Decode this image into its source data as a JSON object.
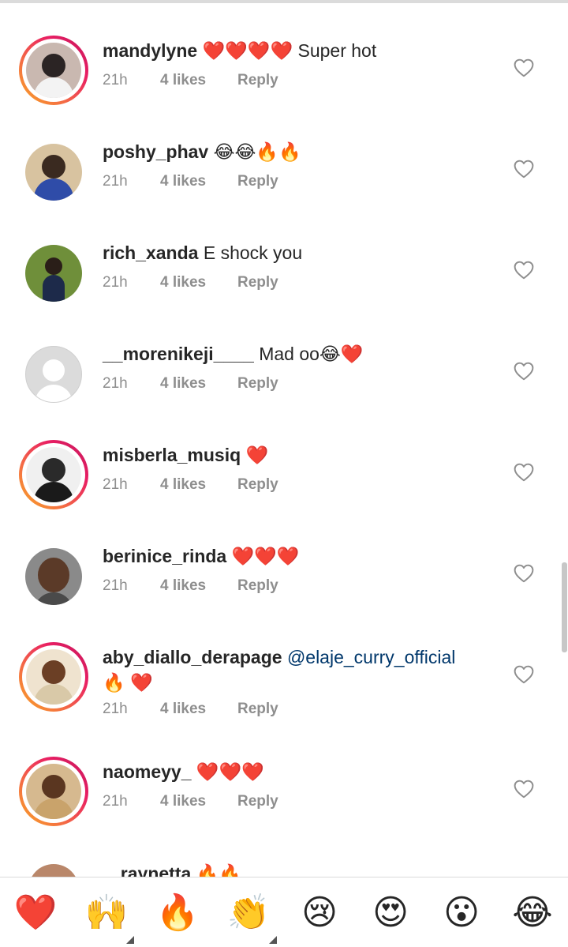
{
  "comments": [
    {
      "username": "mandylyne",
      "text": "❤️❤️❤️❤️ Super hot",
      "mention": "",
      "time": "21h",
      "likes": "4 likes",
      "reply": "Reply"
    },
    {
      "username": "poshy_phav",
      "text": "😂😂🔥🔥",
      "mention": "",
      "time": "21h",
      "likes": "4 likes",
      "reply": "Reply"
    },
    {
      "username": "rich_xanda",
      "text": "E shock you",
      "mention": "",
      "time": "21h",
      "likes": "4 likes",
      "reply": "Reply"
    },
    {
      "username": "__morenikeji____",
      "text": "Mad oo😂❤️",
      "mention": "",
      "time": "21h",
      "likes": "4 likes",
      "reply": "Reply"
    },
    {
      "username": "misberla_musiq",
      "text": "❤️",
      "mention": "",
      "time": "21h",
      "likes": "4 likes",
      "reply": "Reply"
    },
    {
      "username": "berinice_rinda",
      "text": "❤️❤️❤️",
      "mention": "",
      "time": "21h",
      "likes": "4 likes",
      "reply": "Reply"
    },
    {
      "username": "aby_diallo_derapage",
      "text": "🔥 ❤️",
      "mention": "@elaje_curry_official",
      "time": "21h",
      "likes": "4 likes",
      "reply": "Reply"
    },
    {
      "username": "naomeyy_",
      "text": "❤️❤️❤️",
      "mention": "",
      "time": "21h",
      "likes": "4 likes",
      "reply": "Reply"
    },
    {
      "username": "_raynetta",
      "text": "🔥🔥",
      "mention": "",
      "time": "",
      "likes": "",
      "reply": ""
    }
  ],
  "reactions": [
    "❤️",
    "🙌",
    "🔥",
    "👏",
    "😢",
    "😍",
    "😮",
    "😂"
  ],
  "icons": {
    "like": "heart-outline-icon",
    "avatar_placeholder": "person-silhouette-icon"
  },
  "colors": {
    "username": "#262626",
    "meta": "#8e8e8e",
    "mention": "#00376b",
    "story_ring": "#e91e63"
  }
}
